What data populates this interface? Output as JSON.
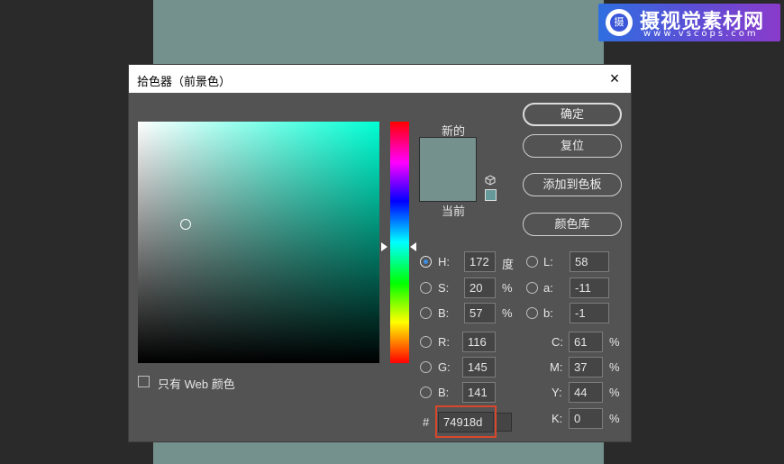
{
  "colors": {
    "current_color": "#74918d",
    "hue_pure": "#00ffd4",
    "highlight": "#d9472b",
    "watermark_gradient": [
      "#2f6fe0",
      "#8a3bcb"
    ]
  },
  "watermark": {
    "logo_char": "摄",
    "title": "摄视觉素材网",
    "url": "www.vscops.com"
  },
  "dialog": {
    "title": "拾色器（前景色）",
    "close_icon": "×"
  },
  "preview": {
    "new_label": "新的",
    "current_label": "当前",
    "new_color": "#74918d",
    "current_color": "#74918d",
    "websafe_color": "#669999",
    "cube_icon": "cube-icon"
  },
  "buttons": {
    "ok": "确定",
    "reset": "复位",
    "add_to_swatches": "添加到色板",
    "color_libraries": "颜色库"
  },
  "web_only": {
    "label": "只有 Web 颜色",
    "checked": false
  },
  "hsb": {
    "h_label": "H:",
    "h_value": "172",
    "h_unit": "度",
    "s_label": "S:",
    "s_value": "20",
    "s_unit": "%",
    "b_label": "B:",
    "b_value": "57",
    "b_unit": "%",
    "selected": "H"
  },
  "rgb": {
    "r_label": "R:",
    "r_value": "116",
    "g_label": "G:",
    "g_value": "145",
    "b_label": "B:",
    "b_value": "141"
  },
  "lab": {
    "l_label": "L:",
    "l_value": "58",
    "a_label": "a:",
    "a_value": "-11",
    "b_label": "b:",
    "b_value": "-1"
  },
  "cmyk": {
    "c_label": "C:",
    "c_value": "61",
    "c_unit": "%",
    "m_label": "M:",
    "m_value": "37",
    "m_unit": "%",
    "y_label": "Y:",
    "y_value": "44",
    "y_unit": "%",
    "k_label": "K:",
    "k_value": "0",
    "k_unit": "%"
  },
  "hex": {
    "label": "#",
    "value": "74918d"
  }
}
